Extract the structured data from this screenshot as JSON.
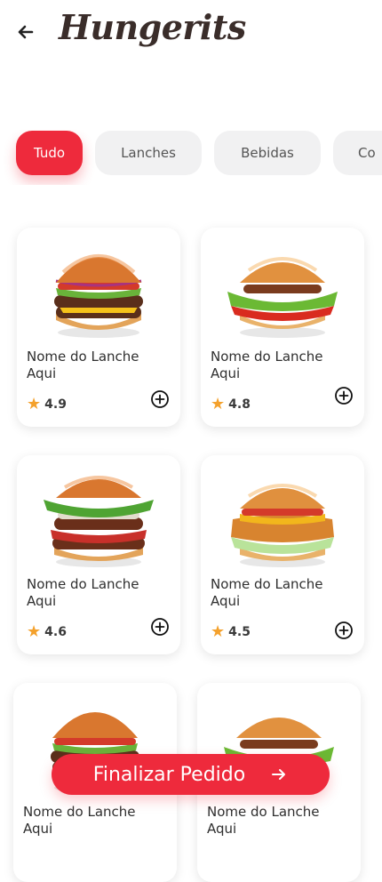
{
  "app": {
    "title": "Hungerits"
  },
  "categories": [
    {
      "label": "Tudo",
      "active": true
    },
    {
      "label": "Lanches",
      "active": false
    },
    {
      "label": "Bebidas",
      "active": false
    },
    {
      "label": "Co",
      "active": false
    }
  ],
  "products": [
    {
      "name": "Nome do Lanche Aqui",
      "rating": "4.9",
      "icon": "burger-image"
    },
    {
      "name": "Nome do Lanche Aqui",
      "rating": "4.8",
      "icon": "burger-image"
    },
    {
      "name": "Nome do Lanche Aqui",
      "rating": "4.6",
      "icon": "burger-image"
    },
    {
      "name": "Nome do Lanche Aqui",
      "rating": "4.5",
      "icon": "burger-image"
    },
    {
      "name": "Nome do Lanche Aqui",
      "rating": "",
      "icon": "burger-image"
    },
    {
      "name": "Nome do Lanche Aqui",
      "rating": "",
      "icon": "burger-image"
    }
  ],
  "footer": {
    "finalize_label": "Finalizar Pedido"
  },
  "colors": {
    "accent": "#ee2a3c",
    "star": "#f4a12c",
    "chip_bg": "#f1f1f2"
  }
}
